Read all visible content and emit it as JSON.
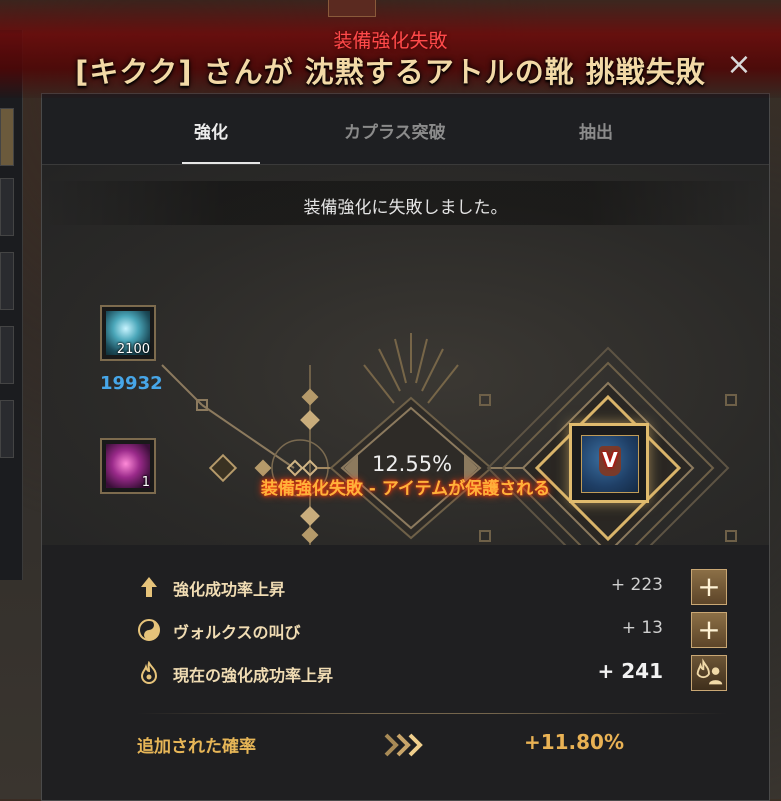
{
  "notification": {
    "small_text": "装備強化失敗",
    "big_text": "[キクク] さんが 沈黙するアトルの靴 挑戦失敗"
  },
  "window": {
    "close_label": "×",
    "tabs": [
      {
        "label": "強化",
        "active": true
      },
      {
        "label": "カプラス突破",
        "active": false
      },
      {
        "label": "抽出",
        "active": false
      }
    ]
  },
  "enhance": {
    "result_message": "装備強化に失敗しました。",
    "material_stone_count": "2100",
    "material_stone_owned": "19932",
    "material_gem_count": "1",
    "success_rate": "12.55%",
    "item_grade": "V",
    "protect_message": "装備強化失敗 - アイテムが保護される"
  },
  "bonuses": [
    {
      "label": "強化成功率上昇",
      "value": "+ 223",
      "icon": "arrow-up-icon",
      "button": "+"
    },
    {
      "label": "ヴォルクスの叫び",
      "value": "+ 13",
      "icon": "yin-yang-icon",
      "button": "+"
    },
    {
      "label": "現在の強化成功率上昇",
      "value": "+ 241",
      "icon": "flame-icon",
      "button": "flame-person-icon"
    }
  ],
  "added": {
    "label": "追加された確率",
    "value": "+11.80%"
  },
  "colors": {
    "accent_gold": "#e7b657",
    "fail_red": "#ff4a4a",
    "count_blue": "#47a6e8"
  }
}
